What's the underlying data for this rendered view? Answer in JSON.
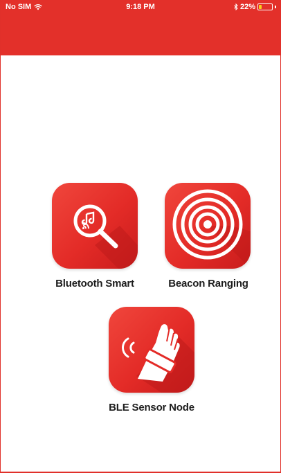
{
  "status_bar": {
    "carrier": "No SIM",
    "time": "9:18 PM",
    "battery_percent": "22%",
    "battery_level": 0.22,
    "wifi_icon": "wifi-icon",
    "bluetooth_icon": "bluetooth-icon"
  },
  "colors": {
    "brand_red": "#e3302a",
    "tile_red": "#e32b27",
    "battery_yellow": "#f6d21b",
    "label_text": "#1c1c1c"
  },
  "apps": [
    {
      "label": "Bluetooth Smart",
      "icon": "bluetooth-smart-search-icon"
    },
    {
      "label": "Beacon Ranging",
      "icon": "beacon-rings-icon"
    },
    {
      "label": "BLE Sensor Node",
      "icon": "wearable-sensor-hand-icon"
    }
  ]
}
